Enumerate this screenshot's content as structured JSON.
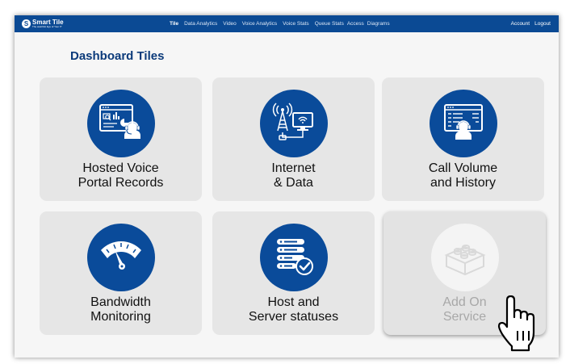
{
  "app": {
    "brand": "Smart Tile",
    "tagline": "The watchful Eye of Your IT"
  },
  "nav": {
    "links": [
      "Tile",
      "Data Analytics",
      "Video",
      "Voice Analytics",
      "Voice Stats",
      "Queue Stats",
      "Access",
      "Diagrams"
    ],
    "active": "Tile",
    "account": "Account",
    "logout": "Logout"
  },
  "page": {
    "title": "Dashboard Tiles"
  },
  "tiles": [
    {
      "line1": "Hosted Voice",
      "line2": "Portal Records",
      "icon": "voice-portal-icon"
    },
    {
      "line1": "Internet",
      "line2": "& Data",
      "icon": "antenna-computer-icon"
    },
    {
      "line1": "Call Volume",
      "line2": "and History",
      "icon": "call-history-icon"
    },
    {
      "line1": "Bandwidth",
      "line2": "Monitoring",
      "icon": "speedometer-icon"
    },
    {
      "line1": "Host and",
      "line2": "Server statuses",
      "icon": "server-check-icon"
    },
    {
      "line1": "Add On",
      "line2": "Service",
      "icon": "lego-brick-icon",
      "disabled": true
    }
  ],
  "colors": {
    "brand_blue": "#0b4a94",
    "icon_circle": "#0a4b9a",
    "title": "#0b3a7a",
    "tile_bg": "#e6e6e6",
    "disabled_text": "#a8a8a8"
  }
}
